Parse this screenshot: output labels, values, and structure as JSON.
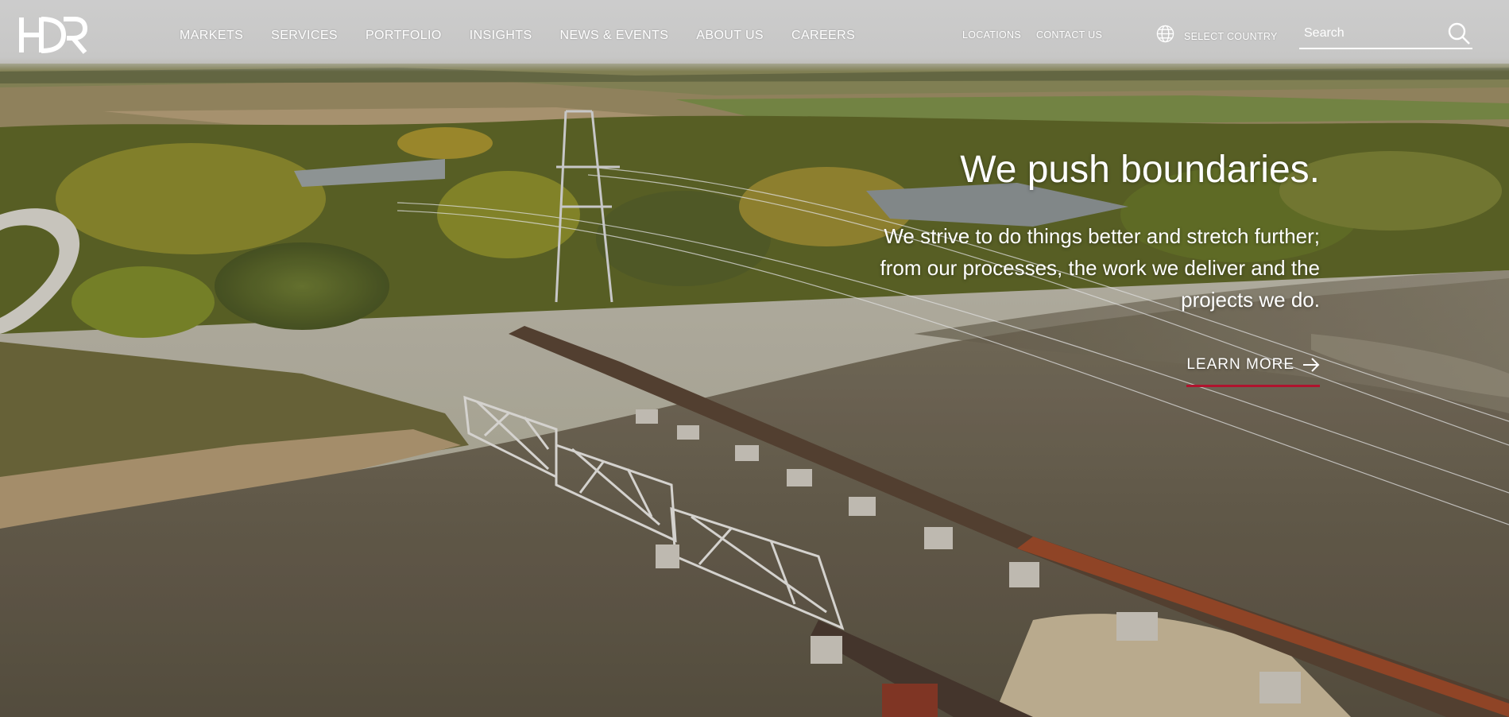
{
  "brand": {
    "logo_text": "HDR",
    "accent_color": "#b0132e"
  },
  "nav": {
    "items": [
      {
        "label": "MARKETS"
      },
      {
        "label": "SERVICES"
      },
      {
        "label": "PORTFOLIO"
      },
      {
        "label": "INSIGHTS"
      },
      {
        "label": "NEWS & EVENTS"
      },
      {
        "label": "ABOUT US"
      },
      {
        "label": "CAREERS"
      }
    ]
  },
  "utility": {
    "locations": "LOCATIONS",
    "contact": "CONTACT US",
    "country_icon": "globe-icon",
    "country_label": "SELECT COUNTRY"
  },
  "search": {
    "placeholder": "Search",
    "value": "",
    "icon": "search-icon"
  },
  "hero": {
    "headline": "We push boundaries.",
    "subcopy": "We strive to do things better and stretch further; from our processes, the work we deliver and the projects we do.",
    "cta_label": "LEARN MORE",
    "cta_icon": "arrow-right-icon",
    "background": "Aerial photo of truss rail bridges over a river in autumn"
  }
}
